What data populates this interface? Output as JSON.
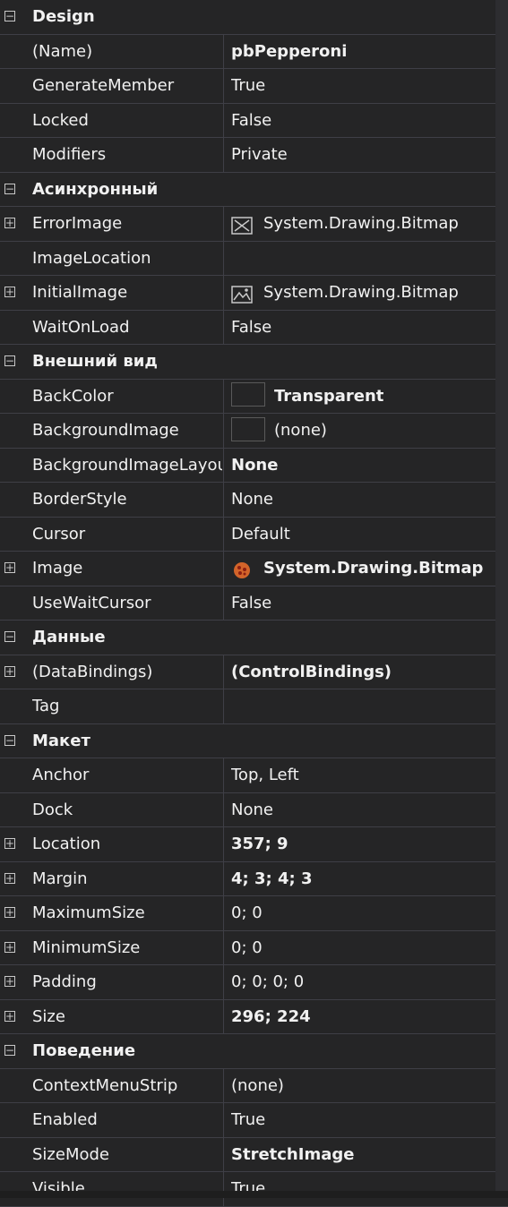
{
  "colors": {
    "background": "#252526",
    "text": "#f1f1f1",
    "grid_line": "#3f3f46",
    "accent_pizza": "#d2642a"
  },
  "rows": [
    {
      "type": "cat",
      "label": "Design",
      "expand": "minus"
    },
    {
      "type": "prop",
      "name": "(Name)",
      "value": "pbPepperoni",
      "bold": true
    },
    {
      "type": "prop",
      "name": "GenerateMember",
      "value": "True"
    },
    {
      "type": "prop",
      "name": "Locked",
      "value": "False"
    },
    {
      "type": "prop",
      "name": "Modifiers",
      "value": "Private"
    },
    {
      "type": "cat",
      "label": "Асинхронный",
      "expand": "minus"
    },
    {
      "type": "prop",
      "name": "ErrorImage",
      "value": "System.Drawing.Bitmap",
      "expand": "plus",
      "icon": "error-image-icon"
    },
    {
      "type": "prop",
      "name": "ImageLocation",
      "value": ""
    },
    {
      "type": "prop",
      "name": "InitialImage",
      "value": "System.Drawing.Bitmap",
      "expand": "plus",
      "icon": "initial-image-icon"
    },
    {
      "type": "prop",
      "name": "WaitOnLoad",
      "value": "False"
    },
    {
      "type": "cat",
      "label": "Внешний вид",
      "expand": "minus"
    },
    {
      "type": "prop",
      "name": "BackColor",
      "value": "Transparent",
      "bold": true,
      "swatch": true
    },
    {
      "type": "prop",
      "name": "BackgroundImage",
      "value": "(none)",
      "swatch": true
    },
    {
      "type": "prop",
      "name": "BackgroundImageLayout",
      "value": "None",
      "bold": true
    },
    {
      "type": "prop",
      "name": "BorderStyle",
      "value": "None"
    },
    {
      "type": "prop",
      "name": "Cursor",
      "value": "Default"
    },
    {
      "type": "prop",
      "name": "Image",
      "value": "System.Drawing.Bitmap",
      "bold": true,
      "expand": "plus",
      "icon": "pizza-image-icon"
    },
    {
      "type": "prop",
      "name": "UseWaitCursor",
      "value": "False"
    },
    {
      "type": "cat",
      "label": "Данные",
      "expand": "minus"
    },
    {
      "type": "prop",
      "name": "(DataBindings)",
      "value": "(ControlBindings)",
      "bold": true,
      "expand": "plus"
    },
    {
      "type": "prop",
      "name": "Tag",
      "value": ""
    },
    {
      "type": "cat",
      "label": "Макет",
      "expand": "minus"
    },
    {
      "type": "prop",
      "name": "Anchor",
      "value": "Top, Left"
    },
    {
      "type": "prop",
      "name": "Dock",
      "value": "None"
    },
    {
      "type": "prop",
      "name": "Location",
      "value": "357; 9",
      "bold": true,
      "expand": "plus"
    },
    {
      "type": "prop",
      "name": "Margin",
      "value": "4; 3; 4; 3",
      "bold": true,
      "expand": "plus"
    },
    {
      "type": "prop",
      "name": "MaximumSize",
      "value": "0; 0",
      "expand": "plus"
    },
    {
      "type": "prop",
      "name": "MinimumSize",
      "value": "0; 0",
      "expand": "plus"
    },
    {
      "type": "prop",
      "name": "Padding",
      "value": "0; 0; 0; 0",
      "expand": "plus"
    },
    {
      "type": "prop",
      "name": "Size",
      "value": "296; 224",
      "bold": true,
      "expand": "plus"
    },
    {
      "type": "cat",
      "label": "Поведение",
      "expand": "minus"
    },
    {
      "type": "prop",
      "name": "ContextMenuStrip",
      "value": "(none)"
    },
    {
      "type": "prop",
      "name": "Enabled",
      "value": "True"
    },
    {
      "type": "prop",
      "name": "SizeMode",
      "value": "StretchImage",
      "bold": true
    },
    {
      "type": "prop",
      "name": "Visible",
      "value": "True"
    }
  ]
}
